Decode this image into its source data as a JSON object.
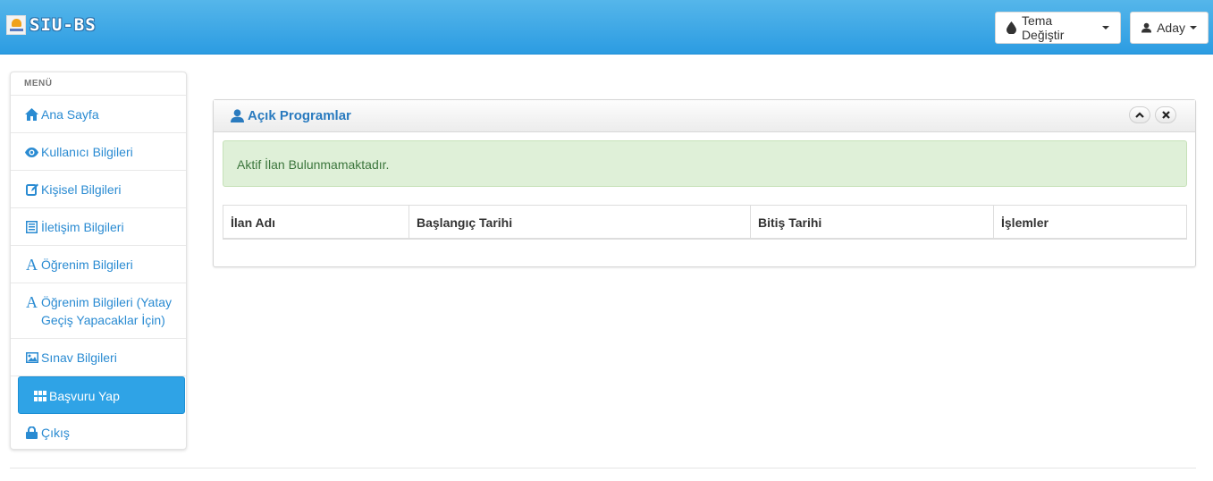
{
  "header": {
    "brand": "SIU-BS",
    "theme_button": "Tema Değiştir",
    "user_button": "Aday"
  },
  "sidebar": {
    "title": "MENÜ",
    "items": [
      {
        "label": "Ana Sayfa",
        "icon": "home-icon"
      },
      {
        "label": "Kullanıcı Bilgileri",
        "icon": "eye-icon"
      },
      {
        "label": "Kişisel Bilgileri",
        "icon": "edit-icon"
      },
      {
        "label": "İletişim Bilgileri",
        "icon": "list-icon"
      },
      {
        "label": "Öğrenim Bilgileri",
        "icon": "font-icon"
      },
      {
        "label": "Öğrenim Bilgileri (Yatay Geçiş Yapacaklar İçin)",
        "icon": "font-icon"
      },
      {
        "label": "Sınav Bilgileri",
        "icon": "picture-icon"
      },
      {
        "label": "Başvuru Yap",
        "icon": "grid-icon",
        "active": true
      },
      {
        "label": "Çıkış",
        "icon": "lock-icon"
      }
    ]
  },
  "panel": {
    "title": "Açık Programlar",
    "alert": "Aktif İlan Bulunmamaktadır.",
    "columns": [
      "İlan Adı",
      "Başlangıç Tarihi",
      "Bitiş Tarihi",
      "İşlemler"
    ]
  },
  "colors": {
    "header_blue": "#2c9ce2",
    "link_blue": "#2a8bd2",
    "active_blue": "#2fa3e6",
    "success_bg": "#dff0d8",
    "success_text": "#3c763d"
  }
}
